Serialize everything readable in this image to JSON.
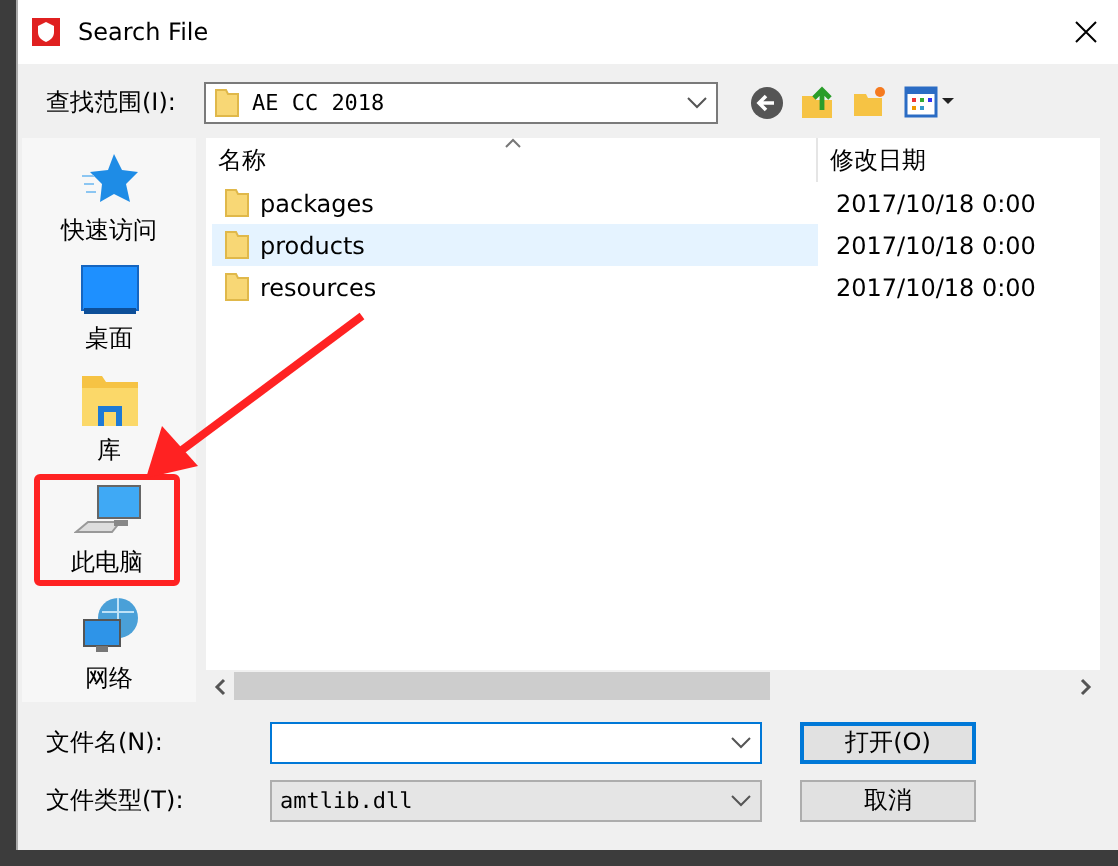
{
  "window": {
    "title": "Search File"
  },
  "toolbar": {
    "look_in_label": "查找范围(I):",
    "location": "AE CC 2018"
  },
  "sidebar": {
    "items": [
      {
        "label": "快速访问",
        "kind": "star",
        "highlighted": false
      },
      {
        "label": "桌面",
        "kind": "desktop",
        "highlighted": false
      },
      {
        "label": "库",
        "kind": "library",
        "highlighted": false
      },
      {
        "label": "此电脑",
        "kind": "computer",
        "highlighted": true
      },
      {
        "label": "网络",
        "kind": "network",
        "highlighted": false
      }
    ]
  },
  "file_list": {
    "columns": [
      "名称",
      "修改日期"
    ],
    "rows": [
      {
        "name": "packages",
        "modified": "2017/10/18 0:00",
        "selected": false
      },
      {
        "name": "products",
        "modified": "2017/10/18 0:00",
        "selected": true
      },
      {
        "name": "resources",
        "modified": "2017/10/18 0:00",
        "selected": false
      }
    ]
  },
  "form": {
    "file_name_label": "文件名(N):",
    "file_type_label": "文件类型(T):",
    "file_type": "amtlib.dll"
  },
  "buttons": [
    {
      "label": "打开(O)",
      "kind": "default"
    },
    {
      "label": "取消",
      "kind": "normal"
    }
  ]
}
